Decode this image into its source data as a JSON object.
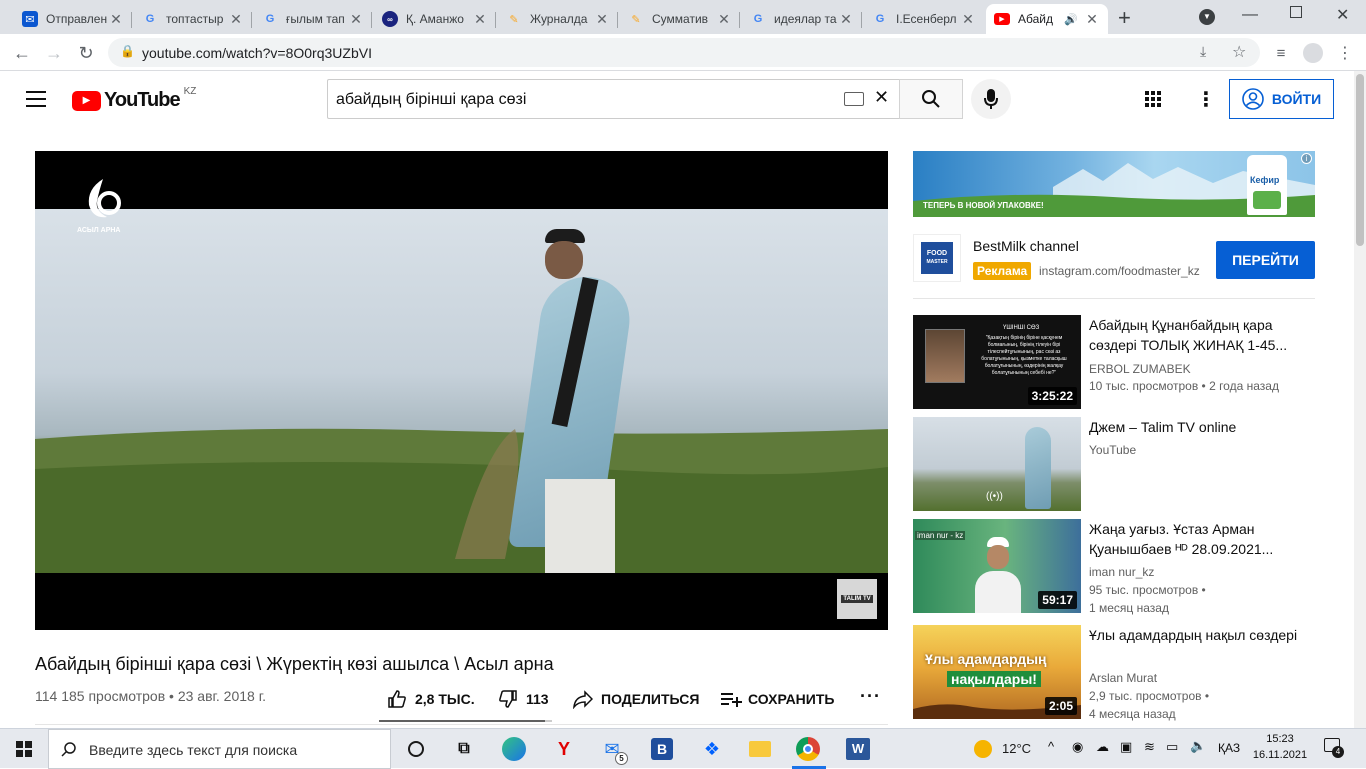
{
  "browser": {
    "tabs": [
      {
        "title": "Отправлен",
        "icon": "mail-icon",
        "color": "#0b57d0"
      },
      {
        "title": "топтастыр",
        "icon": "google-icon",
        "color": "#4285f4"
      },
      {
        "title": "ғылым тап",
        "icon": "google-icon",
        "color": "#4285f4"
      },
      {
        "title": "Қ. Аманжо",
        "icon": "site-icon",
        "color": "#1a237e"
      },
      {
        "title": "Журналда",
        "icon": "site-icon",
        "color": "#f9a825"
      },
      {
        "title": "Сумматив",
        "icon": "site-icon",
        "color": "#f9a825"
      },
      {
        "title": "идеялар та",
        "icon": "google-icon",
        "color": "#4285f4"
      },
      {
        "title": "І.Есенберл",
        "icon": "google-icon",
        "color": "#4285f4"
      },
      {
        "title": "Абайд",
        "icon": "youtube-icon",
        "color": "#ff0000"
      }
    ],
    "url": "youtube.com/watch?v=8O0rq3UZbVI"
  },
  "youtube": {
    "logo_text": "YouTube",
    "region": "KZ",
    "search_query": "абайдың бірінші қара сөзі",
    "signin_label": "ВОЙТИ"
  },
  "player": {
    "channel_logo_text": "АСЫЛ АРНА",
    "corner_badge": "TALIM TV"
  },
  "video": {
    "title": "Абайдың бірінші қара сөзі \\ Жүректің көзі ашылса \\ Асыл арна",
    "views_date": "114 185 просмотров • 23 авг. 2018 г.",
    "likes": "2,8 ТЫС.",
    "dislikes": "113",
    "share_label": "ПОДЕЛИТЬСЯ",
    "save_label": "СОХРАНИТЬ",
    "like_ratio": 0.96
  },
  "ad": {
    "banner_text": "ТЕПЕРЬ В НОВОЙ УПАКОВКЕ!",
    "product_label": "Кефир",
    "logo_line1": "FOOD",
    "logo_line2": "MASTER",
    "channel": "BestMilk channel",
    "badge": "Реклама",
    "link": "instagram.com/foodmaster_kz",
    "cta": "ПЕРЕЙТИ"
  },
  "recommendations": [
    {
      "title": "Абайдың Құнанбайдың қара сөздері ТОЛЫҚ ЖИНАҚ 1-45...",
      "channel": "ERBOL ZUMABEK",
      "meta1": "10 тыс. просмотров • 2 года назад",
      "meta2": "",
      "duration": "3:25:22",
      "thumb_heading": "ҮШІНШІ СӨЗ",
      "thumb_text": "\"Қазақтың бірінің біріне қасқунем болмағының, бірінің тілеуін бірі тілеспейтұғынының, рас сөзі аз болатұғынының, қызметке таласқыш болатұғынының, өздерінің жалқау болатұғынының себебі не?\""
    },
    {
      "title": "Джем – Talim TV online",
      "channel": "YouTube",
      "meta1": "",
      "meta2": "",
      "duration": "",
      "live_symbol": "((•))"
    },
    {
      "title": "Жаңа уағыз. Ұстаз Арман Қуанышбаев ᴴᴰ 28.09.2021...",
      "channel": "iman nur_kz",
      "meta1": "95 тыс. просмотров •",
      "meta2": "1 месяц назад",
      "duration": "59:17",
      "thumb_label": "iman nur - kz"
    },
    {
      "title": "Ұлы адамдардың нақыл сөздері",
      "channel": "Arslan Murat",
      "meta1": "2,9 тыс. просмотров •",
      "meta2": "4 месяца назад",
      "duration": "2:05",
      "thumb_line1": "Ұлы адамдардың",
      "thumb_line2": "нақылдары!"
    }
  ],
  "taskbar": {
    "search_placeholder": "Введите здесь текст для поиска",
    "weather": "12°C",
    "language": "ҚАЗ",
    "time": "15:23",
    "date": "16.11.2021",
    "notifications": "4",
    "mail_badge": "5"
  }
}
